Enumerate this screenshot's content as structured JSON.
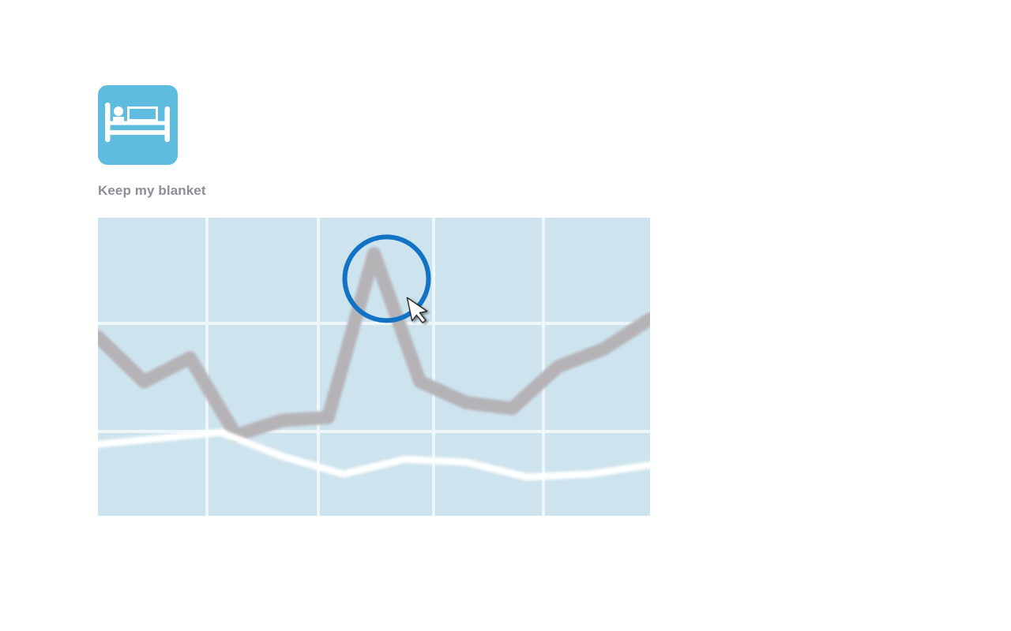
{
  "app": {
    "title": "Keep my blanket",
    "icon": "bed-icon",
    "icon_bg": "#5ebcdf"
  },
  "colors": {
    "chart_bg": "#cde4ee",
    "gridline": "#eef6fa",
    "series_gray": "#b6b3b7",
    "series_white": "#ffffff",
    "highlight_ring": "#1273c4"
  },
  "chart_data": {
    "type": "line",
    "grid": true,
    "x": [
      0,
      1,
      2,
      3,
      4,
      5,
      6,
      7,
      8,
      9,
      10,
      11,
      12
    ],
    "series": [
      {
        "values": [
          60,
          45,
          53,
          27,
          32,
          33,
          88,
          45,
          38,
          36,
          50,
          56,
          66
        ]
      },
      {
        "values": [
          24,
          26,
          28,
          20,
          14,
          19,
          18,
          13,
          14,
          17
        ]
      }
    ],
    "xlim": [
      0,
      12
    ],
    "ylim": [
      0,
      100
    ],
    "highlight": {
      "target": "peak",
      "series_index": 0,
      "point_index": 6
    },
    "cursor": "pointer-icon"
  }
}
